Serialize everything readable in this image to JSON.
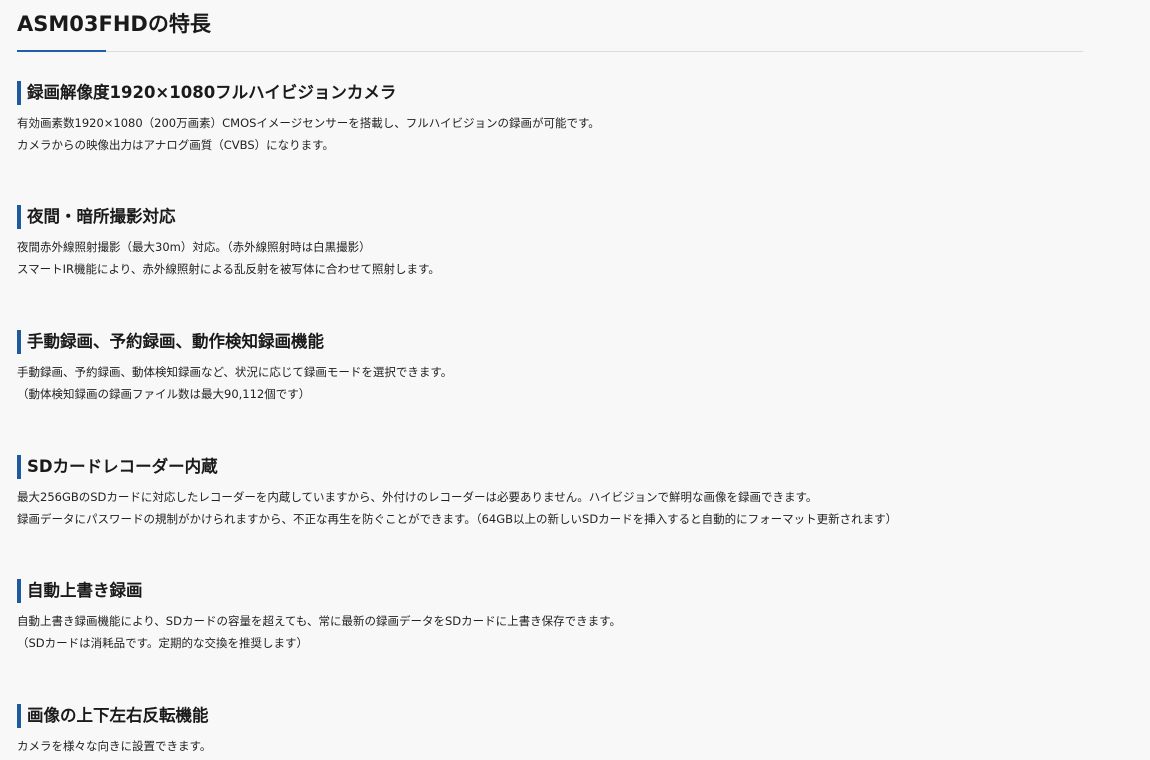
{
  "page": {
    "title": "ASM03FHDの特長"
  },
  "sections": [
    {
      "heading": "録画解像度1920×1080フルハイビジョンカメラ",
      "lines": [
        "有効画素数1920×1080（200万画素）CMOSイメージセンサーを搭載し、フルハイビジョンの録画が可能です。",
        "カメラからの映像出力はアナログ画質（CVBS）になります。"
      ]
    },
    {
      "heading": "夜間・暗所撮影対応",
      "lines": [
        "夜間赤外線照射撮影（最大30m）対応。（赤外線照射時は白黒撮影）",
        "スマートIR機能により、赤外線照射による乱反射を被写体に合わせて照射します。"
      ]
    },
    {
      "heading": "手動録画、予約録画、動作検知録画機能",
      "lines": [
        "手動録画、予約録画、動体検知録画など、状況に応じて録画モードを選択できます。",
        "（動体検知録画の録画ファイル数は最大90,112個です）"
      ]
    },
    {
      "heading": "SDカードレコーダー内蔵",
      "lines": [
        "最大256GBのSDカードに対応したレコーダーを内蔵していますから、外付けのレコーダーは必要ありません。ハイビジョンで鮮明な画像を録画できます。",
        "録画データにパスワードの規制がかけられますから、不正な再生を防ぐことができます。（64GB以上の新しいSDカードを挿入すると自動的にフォーマット更新されます）"
      ]
    },
    {
      "heading": "自動上書き録画",
      "lines": [
        "自動上書き録画機能により、SDカードの容量を超えても、常に最新の録画データをSDカードに上書き保存できます。",
        "（SDカードは消耗品です。定期的な交換を推奨します）"
      ]
    },
    {
      "heading": "画像の上下左右反転機能",
      "lines": [
        "カメラを様々な向きに設置できます。"
      ]
    }
  ]
}
